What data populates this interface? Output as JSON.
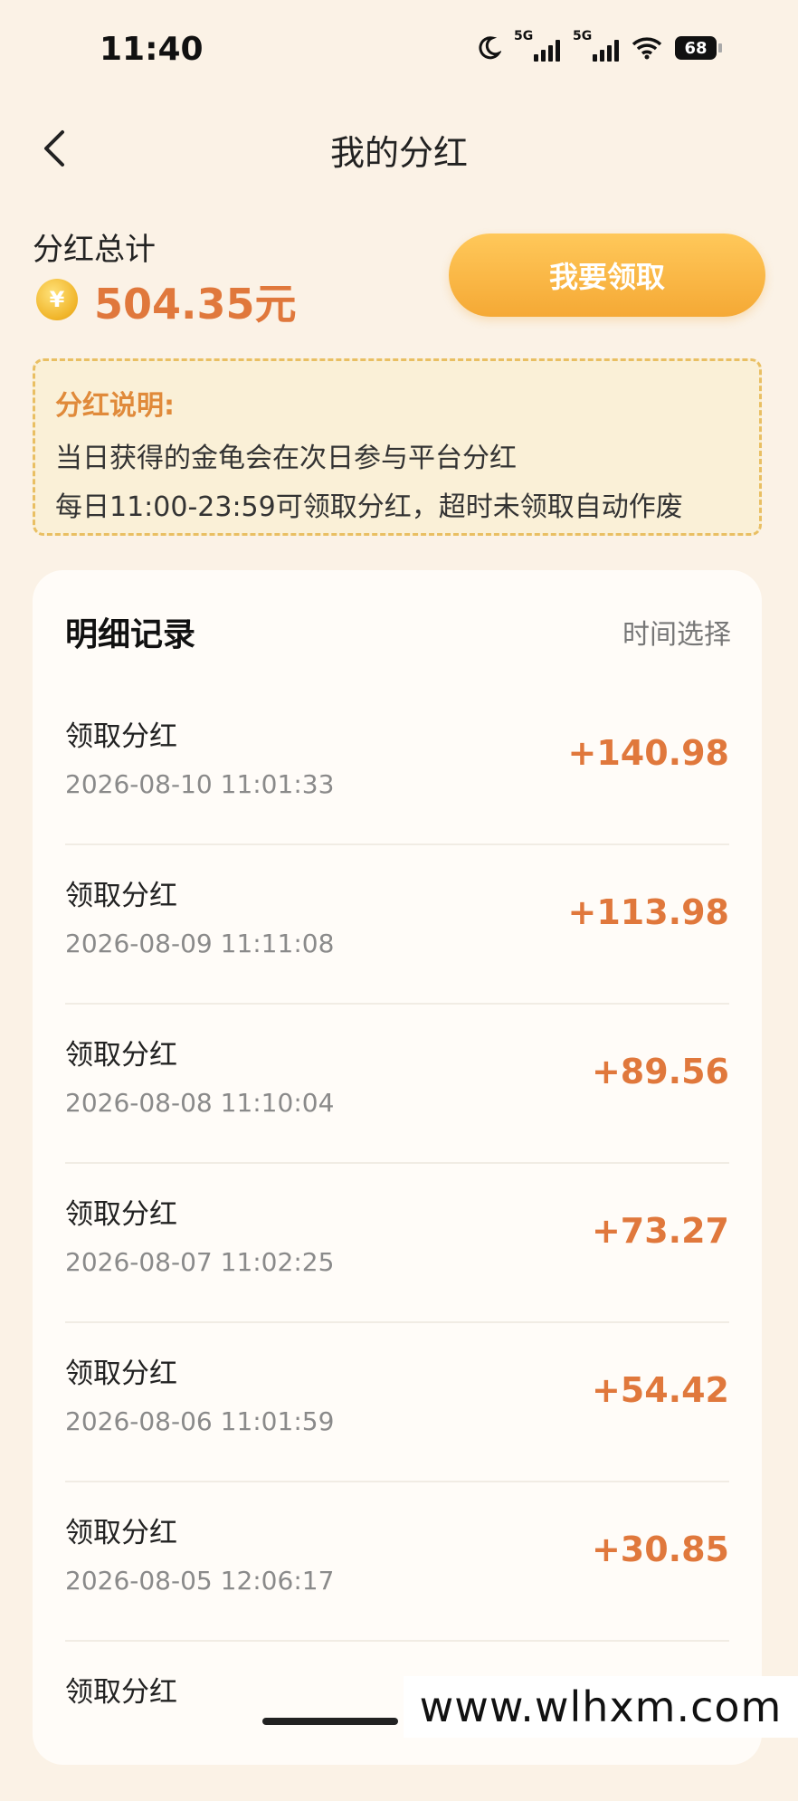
{
  "status_bar": {
    "time": "11:40",
    "signal1_label": "5G",
    "signal2_label": "5G",
    "battery": "68"
  },
  "header": {
    "title": "我的分红"
  },
  "summary": {
    "label": "分红总计",
    "coin_symbol": "¥",
    "amount": "504.35元",
    "claim_button": "我要领取"
  },
  "notice": {
    "title": "分红说明:",
    "lines": [
      "当日获得的金龟会在次日参与平台分红",
      "每日11:00-23:59可领取分红，超时未领取自动作废"
    ]
  },
  "records": {
    "title": "明细记录",
    "filter_label": "时间选择",
    "items": [
      {
        "title": "领取分红",
        "time": "2026-08-10 11:01:33",
        "amount": "+140.98"
      },
      {
        "title": "领取分红",
        "time": "2026-08-09 11:11:08",
        "amount": "+113.98"
      },
      {
        "title": "领取分红",
        "time": "2026-08-08 11:10:04",
        "amount": "+89.56"
      },
      {
        "title": "领取分红",
        "time": "2026-08-07 11:02:25",
        "amount": "+73.27"
      },
      {
        "title": "领取分红",
        "time": "2026-08-06 11:01:59",
        "amount": "+54.42"
      },
      {
        "title": "领取分红",
        "time": "2026-08-05 12:06:17",
        "amount": "+30.85"
      },
      {
        "title": "领取分红"
      }
    ]
  },
  "watermark": "www.wlhxm.com",
  "colors": {
    "accent": "#e0783c",
    "button": "#f5a935",
    "background": "#fbf2e6"
  }
}
